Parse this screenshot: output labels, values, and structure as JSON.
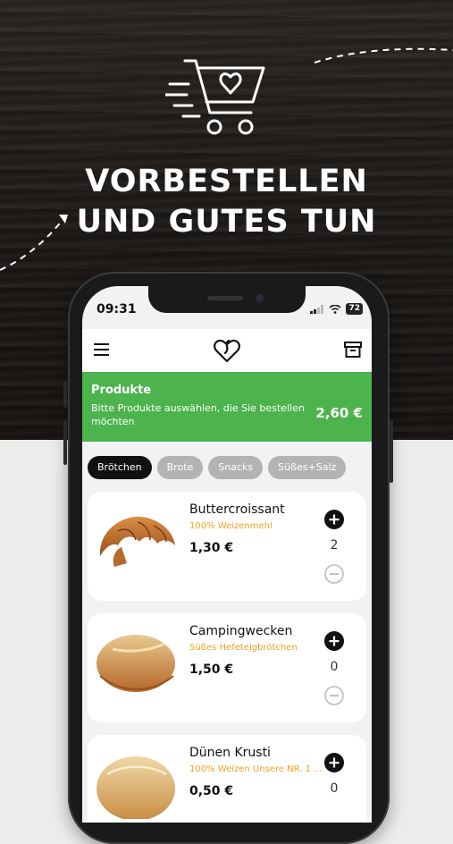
{
  "hero": {
    "headline_line1": "VORBESTELLEN",
    "headline_line2": "UND GUTES TUN"
  },
  "status_bar": {
    "time": "09:31",
    "battery": "72"
  },
  "app_bar": {
    "menu_icon": "hamburger-icon",
    "logo_icon": "heart-logo-icon",
    "archive_icon": "archive-box-icon"
  },
  "banner": {
    "title": "Produkte",
    "description": "Bitte Produkte auswählen, die Sie bestellen möchten",
    "total": "2,60 €",
    "color": "#4db34d"
  },
  "categories": [
    {
      "label": "Brötchen",
      "active": true
    },
    {
      "label": "Brote",
      "active": false
    },
    {
      "label": "Snacks",
      "active": false
    },
    {
      "label": "Süßes+Salz",
      "active": false
    }
  ],
  "products": [
    {
      "name": "Buttercroissant",
      "subtitle": "100% Weizenmehl",
      "price": "1,30 €",
      "quantity": "2"
    },
    {
      "name": "Campingwecken",
      "subtitle": "Süßes Hefeteigbrötchen",
      "price": "1,50 €",
      "quantity": "0"
    },
    {
      "name": "Dünen Krusti",
      "subtitle": "100% Weizen Unsere NR. 1 ...",
      "price": "0,50 €",
      "quantity": "0"
    }
  ],
  "colors": {
    "accent_green": "#4db34d",
    "subtitle_orange": "#f0a21f",
    "active_chip": "#111111",
    "inactive_chip": "#b3b3b3"
  }
}
